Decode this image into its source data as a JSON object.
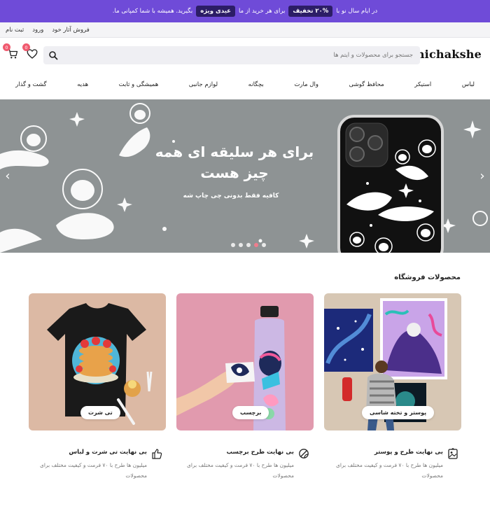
{
  "topbar": {
    "text_start": "در ایام سال نو با",
    "discount_pill": "۲۰% تخفیف",
    "text_middle": "برای هر خرید از ما",
    "special_pill": "عیدی ویژه",
    "text_end": "بگیرید. همیشه با شما کمپانی ما."
  },
  "util": {
    "sell_art": "فروش آثار خود",
    "login": "ورود",
    "register": "ثبت نام"
  },
  "header": {
    "logo": "chichakshe",
    "search_placeholder": "جستجو برای محصولات و آیتم ها",
    "wishlist_count": "0",
    "cart_count": "0"
  },
  "nav": {
    "items": [
      {
        "label": "لباس"
      },
      {
        "label": "استیکر"
      },
      {
        "label": "محافظ گوشی"
      },
      {
        "label": "وال مارت"
      },
      {
        "label": "بچگانه"
      },
      {
        "label": "لوازم جانبی"
      },
      {
        "label": "همیشگی و ثابت"
      },
      {
        "label": "هدیه"
      },
      {
        "label": "گشت و گذار"
      }
    ]
  },
  "hero": {
    "title": "برای هر سلیقه ای همه چیز هست",
    "subtitle": "کافیه فقط بدونی چی چاپ شه",
    "slides_total": 5,
    "active_slide": 4
  },
  "products": {
    "title": "محصولات فروشگاه",
    "cards": [
      {
        "label": "پوستر و تخته شاسی"
      },
      {
        "label": "برچسب"
      },
      {
        "label": "تی شرت"
      }
    ]
  },
  "features": [
    {
      "title": "بی نهایت طرح و پوستر",
      "desc": "میلیون ها طرح با ۷۰ فرمت و کیفیت مختلف برای محصولات",
      "icon": "poster-icon"
    },
    {
      "title": "بی نهایت طرح برچسب",
      "desc": "میلیون ها طرح با ۷۰ فرمت و کیفیت مختلف برای محصولات",
      "icon": "sticker-icon"
    },
    {
      "title": "بی نهایت تی شرت و لباس",
      "desc": "میلیون ها طرح با ۷۰ فرمت و کیفیت مختلف برای محصولات",
      "icon": "thumbs-up-icon"
    }
  ],
  "colors": {
    "topbar": "#6f4bd8",
    "pill": "#2c1d66",
    "hero_bg": "#8e9394",
    "badge": "#f05a6f"
  }
}
